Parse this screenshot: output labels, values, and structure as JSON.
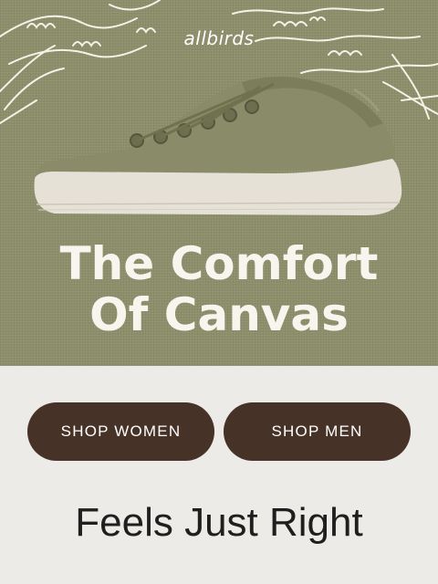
{
  "hero": {
    "brand": "allbirds",
    "headline_line1": "The Comfort",
    "headline_line2": "Of Canvas",
    "background_color": "#8d8f6c",
    "shoe_color": "#8a8c69",
    "sole_color": "#e6e1d6"
  },
  "buttons": {
    "women_label": "SHOP WOMEN",
    "men_label": "SHOP MEN",
    "color": "#473228"
  },
  "tagline": "Feels Just Right"
}
